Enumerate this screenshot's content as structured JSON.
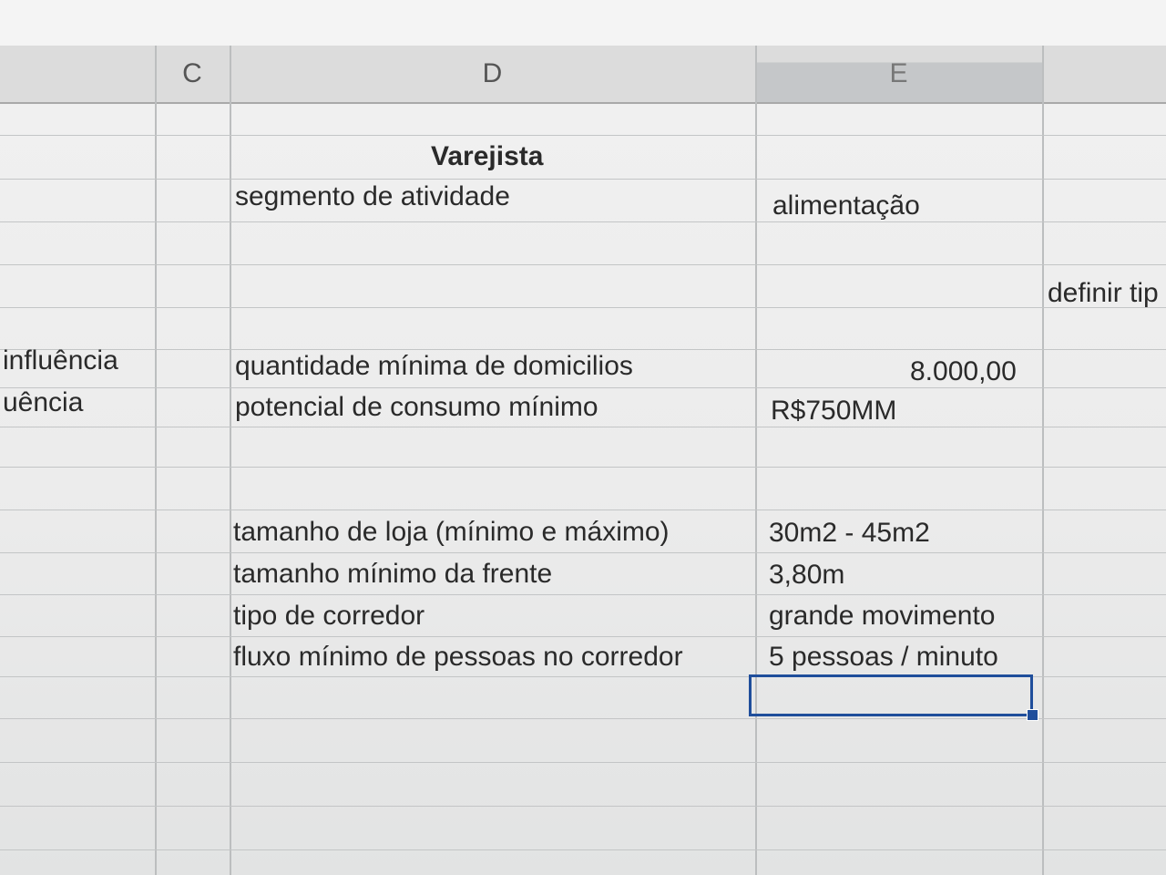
{
  "columns": {
    "c": "C",
    "d": "D",
    "e": "E"
  },
  "cells": {
    "title": "Varejista",
    "segmento_label": "segmento de atividade",
    "segmento_value": "alimentação",
    "definir_tipo": "definir tip",
    "influencia_1": "influência",
    "influencia_2": "uência",
    "domicilios_label": "quantidade mínima de domicilios",
    "domicilios_value": "8.000,00",
    "consumo_label": "potencial de consumo mínimo",
    "consumo_value": "R$750MM",
    "loja_label": "tamanho de loja (mínimo e máximo)",
    "loja_value": "30m2 - 45m2",
    "frente_label": "tamanho mínimo da frente",
    "frente_value": "3,80m",
    "corredor_label": "tipo de corredor",
    "corredor_value": "grande movimento",
    "fluxo_label": "fluxo mínimo de pessoas no corredor",
    "fluxo_value": "5 pessoas / minuto"
  }
}
